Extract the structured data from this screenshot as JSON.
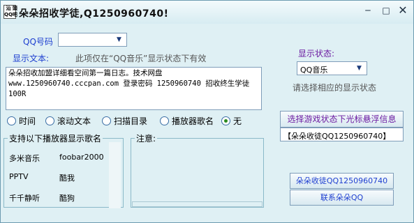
{
  "window": {
    "title": "朵朵招收学徒,Q1250960740!",
    "icon_glyphs": [
      "汕",
      "頭",
      "QQ",
      "吧"
    ],
    "controls": {
      "minimize": "‒",
      "maximize": "□",
      "close": "✕"
    }
  },
  "qq_field": {
    "label": "QQ号码",
    "value": ""
  },
  "display_text": {
    "label": "显示文本:",
    "hint": "此项仅在“QQ音乐”显示状态下有效",
    "content": "朵朵招收加盟详细看空间第一篇日志。技术网盘\nwww.1250960740.cccpan.com 登录密码 1250960740 招收终生学徒\n100R"
  },
  "status": {
    "label": "显示状态:",
    "selected": "QQ音乐",
    "hint": "请选择相应的显示状态"
  },
  "modes": [
    {
      "label": "时间",
      "selected": false
    },
    {
      "label": "滚动文本",
      "selected": false
    },
    {
      "label": "扫描目录",
      "selected": false
    },
    {
      "label": "播放器歌名",
      "selected": false
    },
    {
      "label": "无",
      "selected": true
    }
  ],
  "players": {
    "title": "支持以下播放器显示歌名",
    "rows": [
      [
        "多米音乐",
        "foobar2000"
      ],
      [
        "PPTV",
        "酷我"
      ],
      [
        "千千静听",
        "酷狗"
      ]
    ]
  },
  "notes": {
    "title": "注意:"
  },
  "game_hover": {
    "button": "选择游戏状态下光标悬浮信息",
    "value": "【朵朵收徒QQ1250960740】"
  },
  "buttons": {
    "apprentice": "朵朵收徒QQ1250960740",
    "contact": "联系朵朵QQ"
  },
  "colors": {
    "label_blue": "#1e3fd0",
    "label_purple": "#6b1aa1",
    "window_bg": "#dff0f4"
  }
}
